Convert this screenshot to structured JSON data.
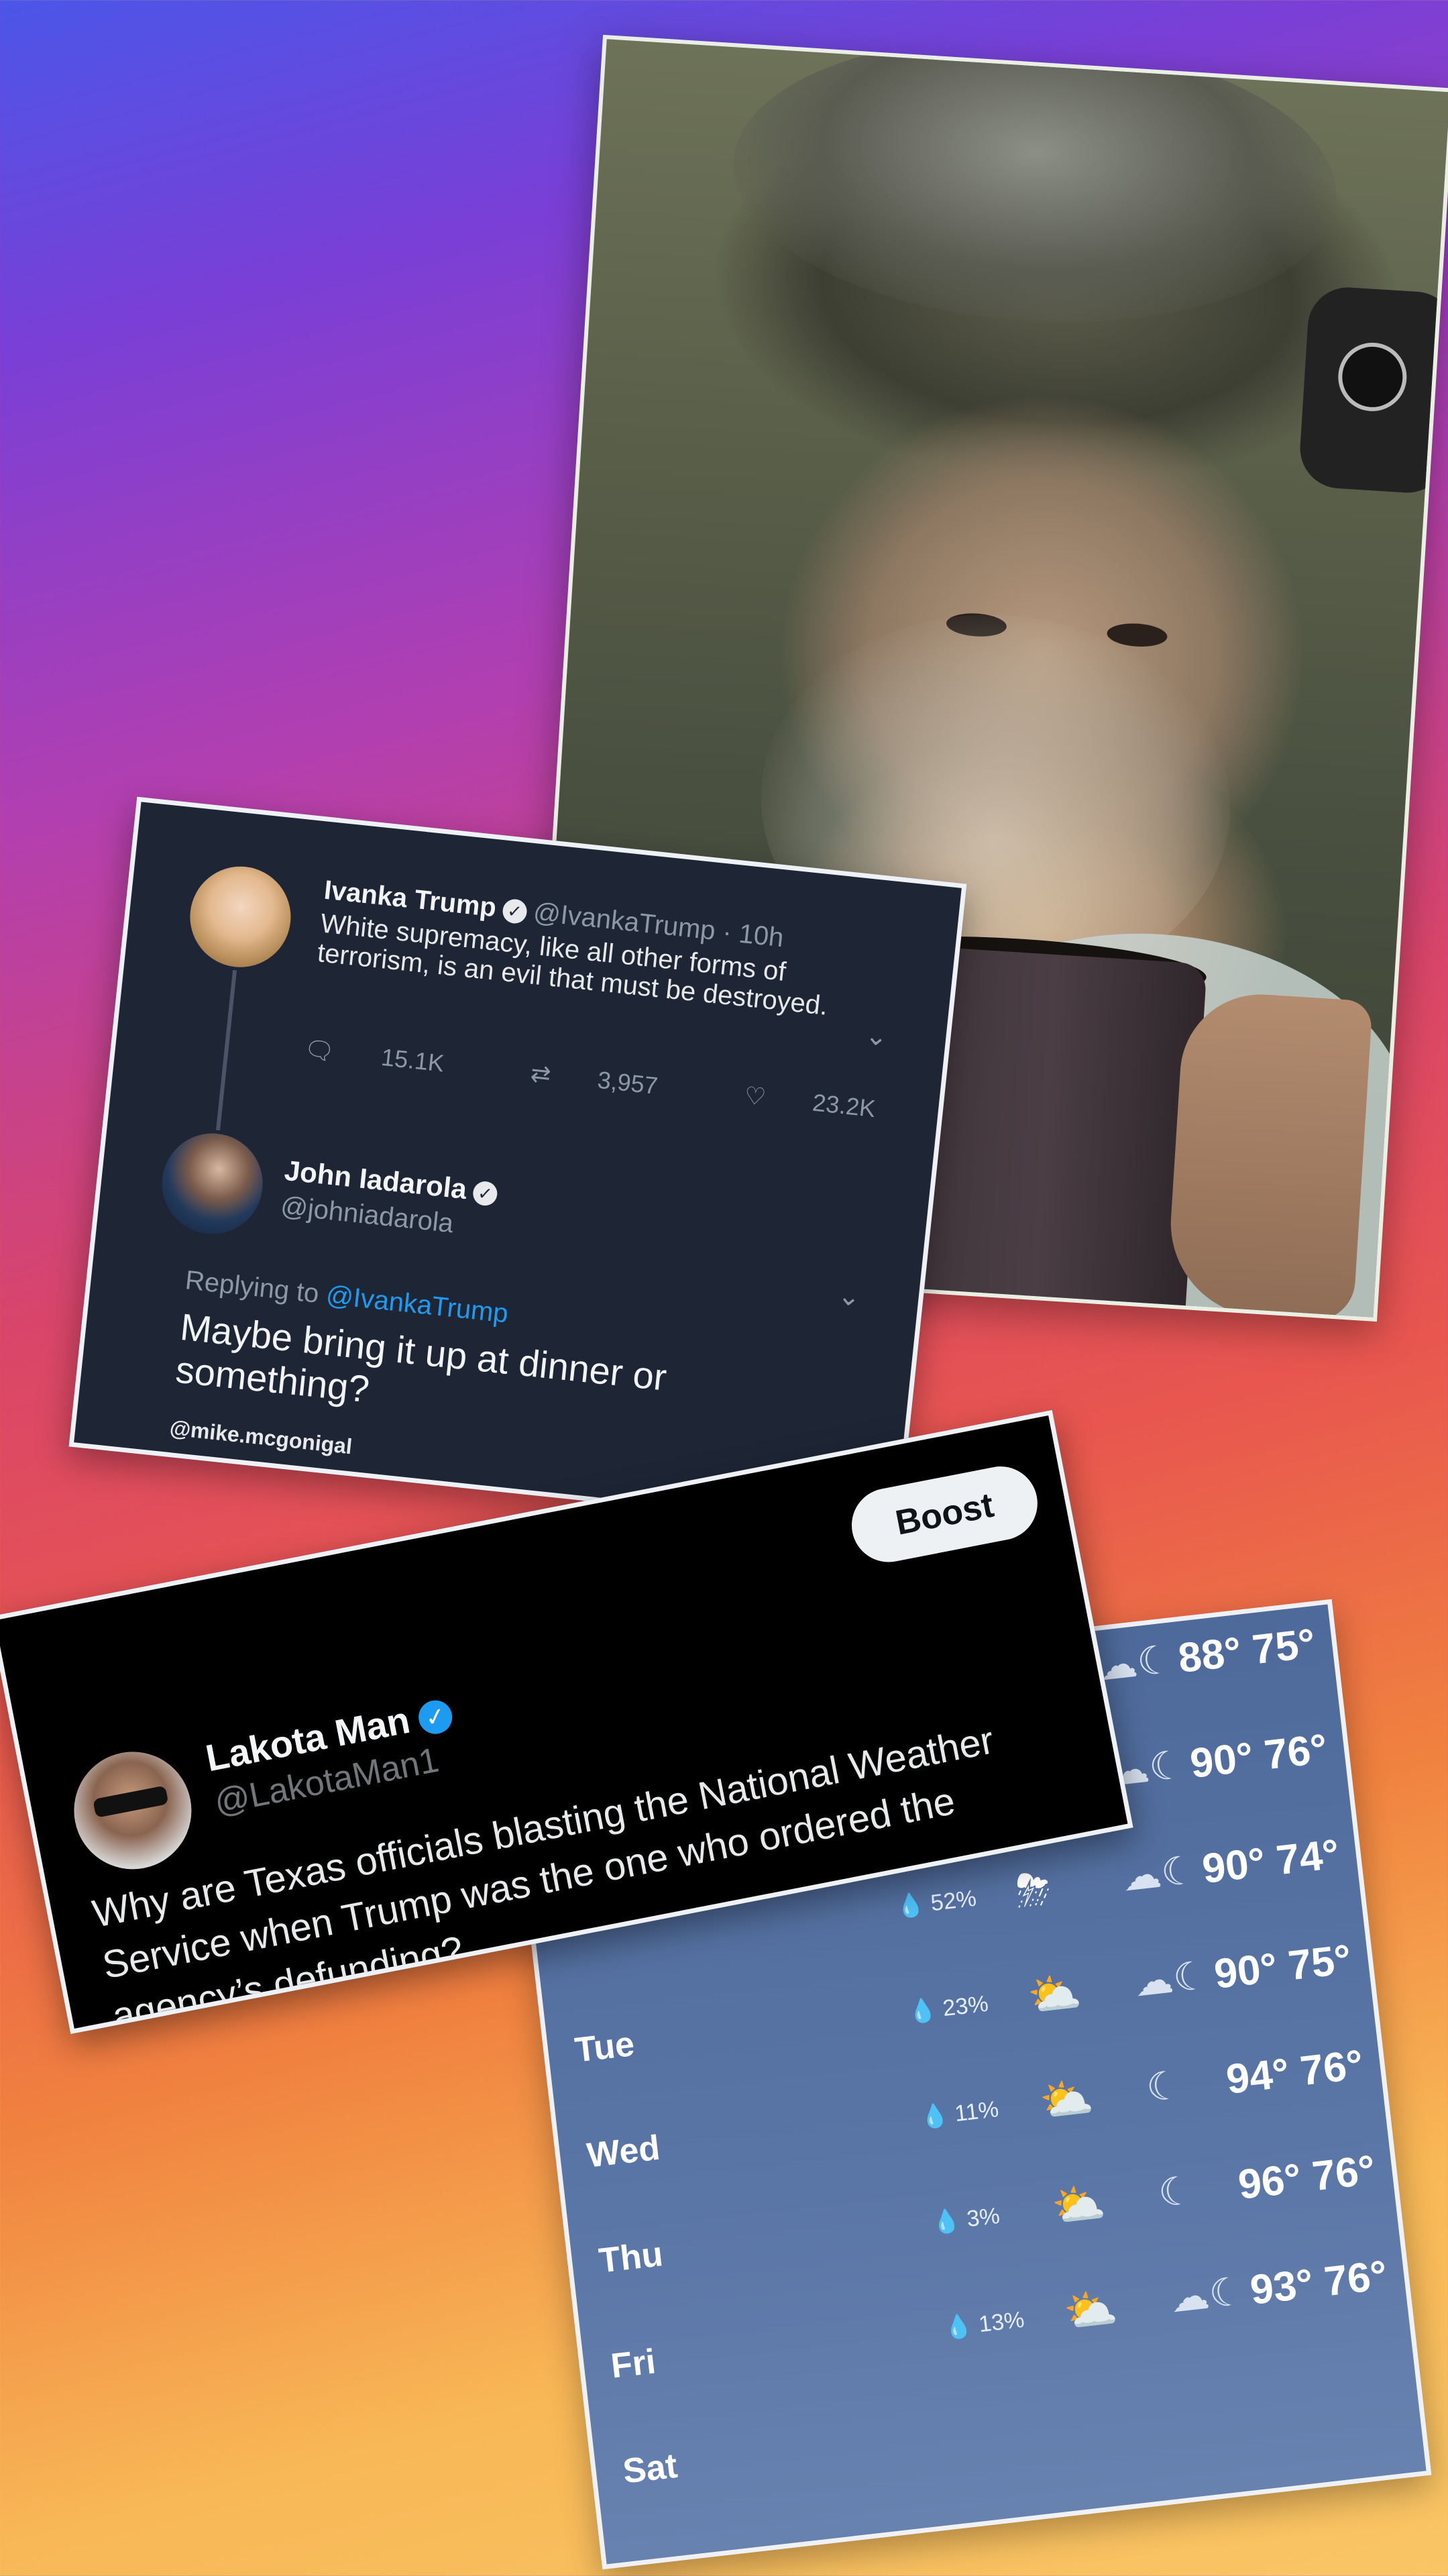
{
  "tweet_iadarola": {
    "original": {
      "name": "Ivanka Trump",
      "handle_time": "@IvankaTrump · 10h",
      "text": "White supremacy, like all other forms of terrorism, is an evil that must be destroyed.",
      "replies": "15.1K",
      "retweets": "3,957",
      "likes": "23.2K"
    },
    "reply": {
      "name": "John Iadarola",
      "handle": "@johniadarola",
      "replying_to_label": "Replying to",
      "replying_to_handle": "@IvankaTrump",
      "text": "Maybe bring it up at dinner or something?"
    },
    "credit": "@mike.mcgonigal"
  },
  "tweet_lakota": {
    "boost_label": "Boost",
    "name": "Lakota Man",
    "handle": "@LakotaMan1",
    "text": "Why are Texas officials blasting the National Weather Service when Trump was the one who ordered the agency’s defunding?"
  },
  "weather": {
    "rows": [
      {
        "day": "",
        "precip": "",
        "temps": "88° 75°",
        "day_icon": "",
        "night_icon": "moon-cloud-icon"
      },
      {
        "day": "",
        "precip": "",
        "temps": "90° 76°",
        "day_icon": "",
        "night_icon": "moon-cloud-icon"
      },
      {
        "day": "",
        "precip": "52%",
        "temps": "90° 74°",
        "day_icon": "thunderstorm-icon",
        "night_icon": "moon-cloud-icon"
      },
      {
        "day": "Tue",
        "precip": "23%",
        "temps": "90° 75°",
        "day_icon": "partly-sunny-icon",
        "night_icon": "moon-cloud-icon"
      },
      {
        "day": "Wed",
        "precip": "11%",
        "temps": "94° 76°",
        "day_icon": "partly-sunny-icon",
        "night_icon": "moon-icon"
      },
      {
        "day": "Thu",
        "precip": "3%",
        "temps": "96° 76°",
        "day_icon": "partly-sunny-icon",
        "night_icon": "moon-icon"
      },
      {
        "day": "Fri",
        "precip": "13%",
        "temps": "93° 76°",
        "day_icon": "partly-sunny-icon",
        "night_icon": "moon-cloud-icon"
      },
      {
        "day": "Sat",
        "precip": "",
        "temps": "",
        "day_icon": "",
        "night_icon": ""
      }
    ]
  },
  "icons": {
    "thunderstorm-icon": "⛈",
    "partly-sunny-icon": "⛅",
    "moon-icon": "☾",
    "moon-cloud-icon": "☁☾"
  }
}
